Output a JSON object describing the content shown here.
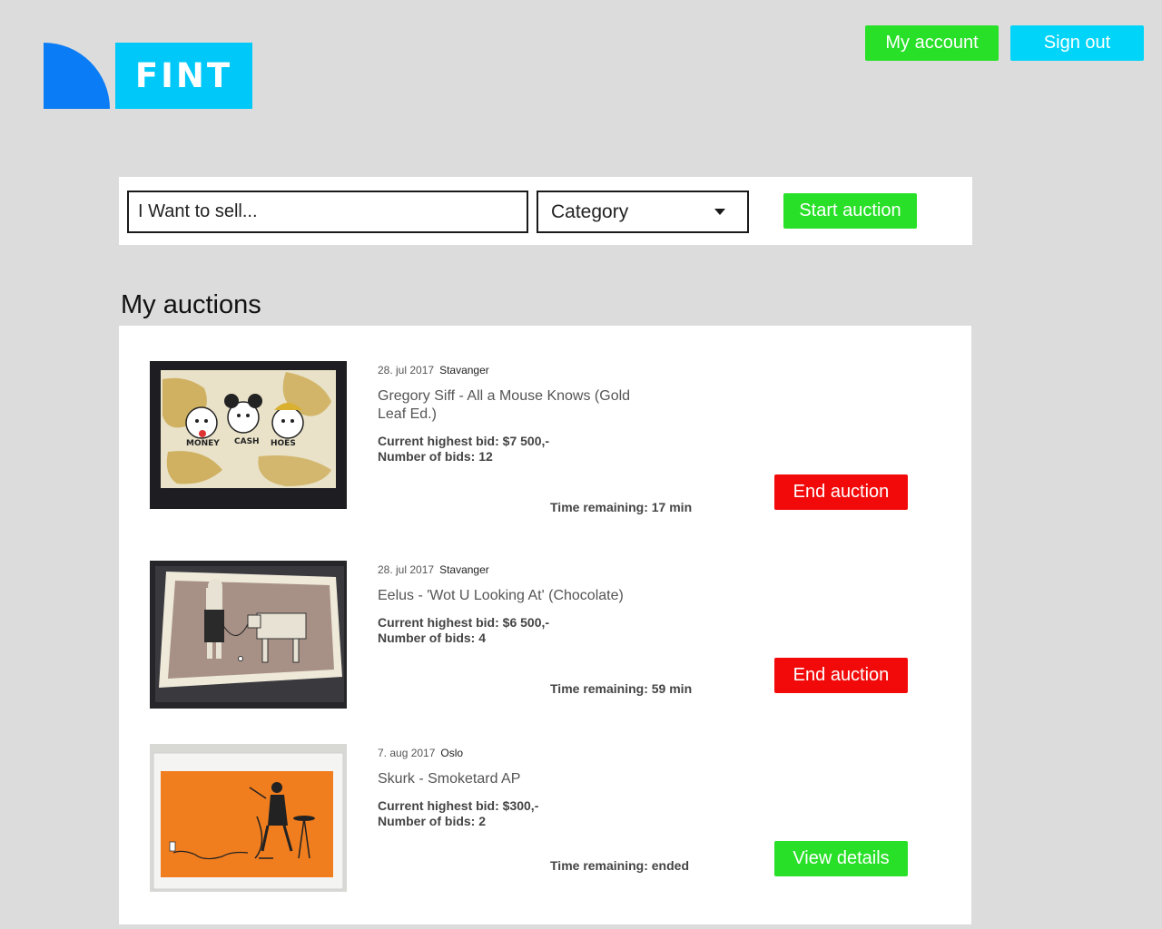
{
  "brand": {
    "name": "FINT"
  },
  "header": {
    "my_account": "My account",
    "sign_out": "Sign out"
  },
  "sell": {
    "input_value": "I Want to sell...",
    "category": "Category",
    "start_button": "Start auction"
  },
  "section_title": "My auctions",
  "auctions": [
    {
      "date": "28. jul 2017",
      "city": "Stavanger",
      "title": "Gregory Siff - All a Mouse Knows (Gold Leaf Ed.)",
      "bid": "Current highest bid: $7 500,-",
      "count": "Number of bids: 12",
      "time": "Time remaining: 17 min",
      "action": "End auction",
      "thumb_labels": [
        "MONEY",
        "CASH",
        "HOES"
      ]
    },
    {
      "date": "28. jul 2017",
      "city": "Stavanger",
      "title": "Eelus - 'Wot U Looking At' (Chocolate)",
      "bid": "Current highest bid: $6 500,-",
      "count": "Number of bids: 4",
      "time": "Time remaining: 59 min",
      "action": "End auction"
    },
    {
      "date": "7. aug 2017",
      "city": "Oslo",
      "title": "Skurk - Smoketard AP",
      "bid": "Current highest bid: $300,-",
      "count": "Number of bids: 2",
      "time": "Time remaining: ended",
      "action": "View details"
    }
  ],
  "colors": {
    "green": "#28e028",
    "cyan": "#00d4f8",
    "blue": "#0a7cf5",
    "red": "#f20a0a",
    "background": "#dcdcdc"
  }
}
